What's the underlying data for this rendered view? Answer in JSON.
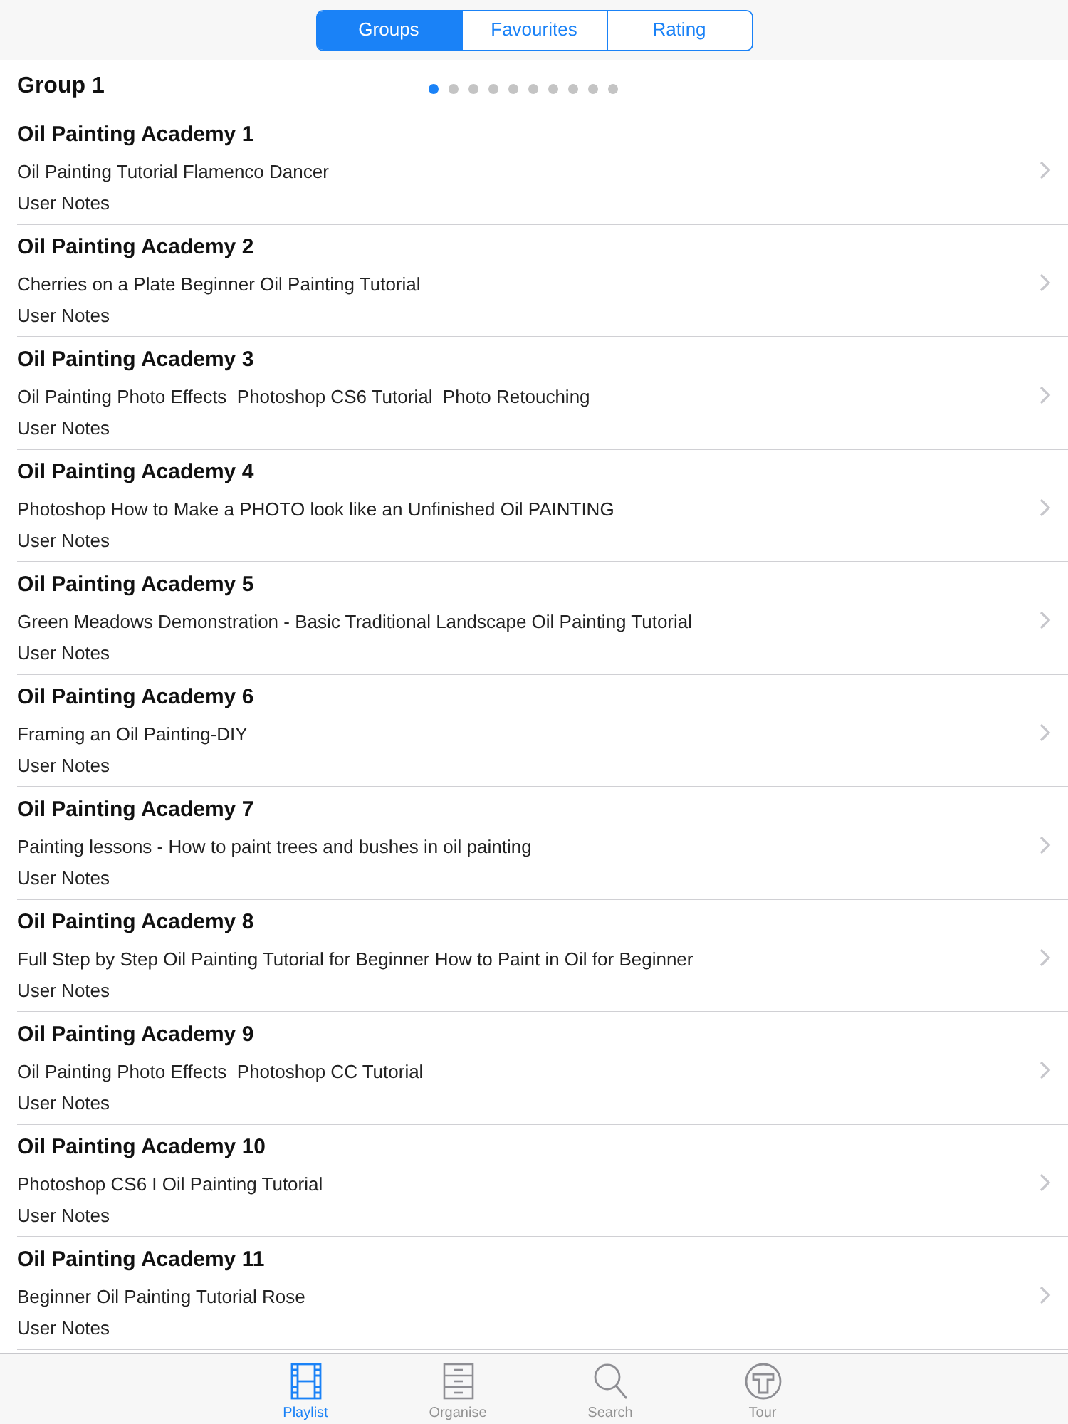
{
  "segments": [
    {
      "label": "Groups",
      "selected": true
    },
    {
      "label": "Favourites",
      "selected": false
    },
    {
      "label": "Rating",
      "selected": false
    }
  ],
  "group": {
    "title": "Group 1",
    "page_dots": [
      {
        "selected": true
      },
      {
        "selected": false
      },
      {
        "selected": false
      },
      {
        "selected": false
      },
      {
        "selected": false
      },
      {
        "selected": false
      },
      {
        "selected": false
      },
      {
        "selected": false
      },
      {
        "selected": false
      },
      {
        "selected": false
      }
    ]
  },
  "rows": [
    {
      "title": "Oil Painting Academy 1",
      "subtitle": "Oil Painting Tutorial Flamenco Dancer",
      "notes": "User Notes"
    },
    {
      "title": "Oil Painting Academy 2",
      "subtitle": "Cherries on a Plate Beginner Oil Painting Tutorial",
      "notes": "User Notes"
    },
    {
      "title": "Oil Painting Academy 3",
      "subtitle": "Oil Painting Photo Effects  Photoshop CS6 Tutorial  Photo Retouching",
      "notes": "User Notes"
    },
    {
      "title": "Oil Painting Academy 4",
      "subtitle": "Photoshop How to Make a PHOTO look like an Unfinished Oil PAINTING",
      "notes": "User Notes"
    },
    {
      "title": "Oil Painting Academy 5",
      "subtitle": "Green Meadows Demonstration - Basic Traditional Landscape Oil Painting Tutorial",
      "notes": "User Notes"
    },
    {
      "title": "Oil Painting Academy 6",
      "subtitle": "Framing an Oil Painting-DIY",
      "notes": "User Notes"
    },
    {
      "title": "Oil Painting Academy 7",
      "subtitle": "Painting lessons - How to paint trees and bushes in oil painting",
      "notes": "User Notes"
    },
    {
      "title": "Oil Painting Academy 8",
      "subtitle": "Full Step by Step Oil Painting Tutorial for Beginner How to Paint in Oil for Beginner",
      "notes": "User Notes"
    },
    {
      "title": "Oil Painting Academy 9",
      "subtitle": "Oil Painting Photo Effects  Photoshop CC Tutorial",
      "notes": "User Notes"
    },
    {
      "title": "Oil Painting Academy 10",
      "subtitle": "Photoshop CS6 I Oil Painting Tutorial",
      "notes": "User Notes"
    },
    {
      "title": "Oil Painting Academy 11",
      "subtitle": "Beginner Oil Painting Tutorial Rose",
      "notes": "User Notes"
    }
  ],
  "tab_bar": [
    {
      "kind": "film",
      "label": "Playlist",
      "selected": true
    },
    {
      "kind": "drawer",
      "label": "Organise",
      "selected": false
    },
    {
      "kind": "search",
      "label": "Search",
      "selected": false
    },
    {
      "kind": "tour",
      "label": "Tour",
      "selected": false
    }
  ]
}
